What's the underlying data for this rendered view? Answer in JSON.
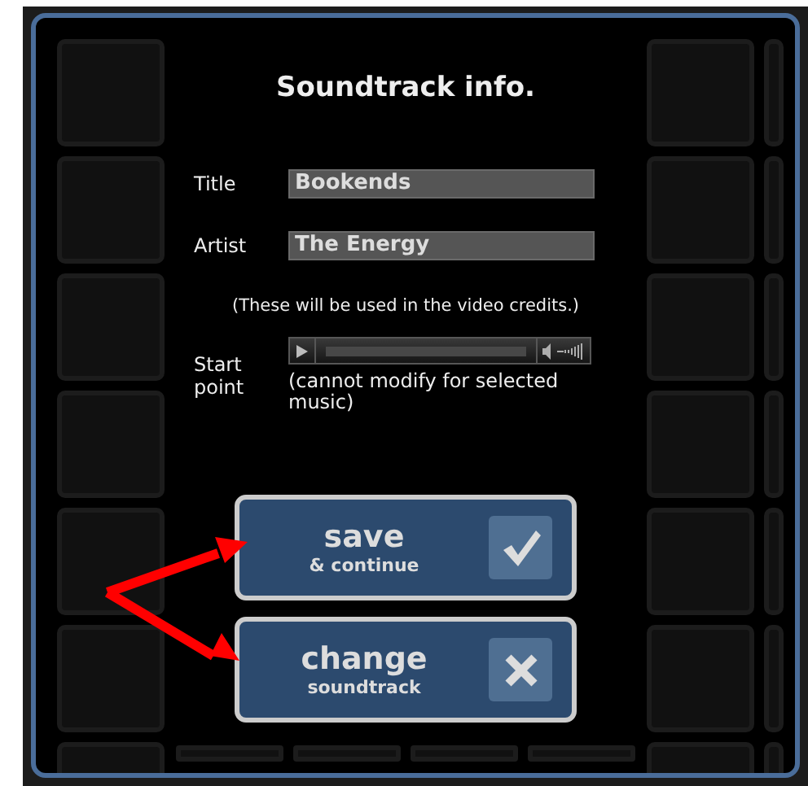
{
  "title": "Soundtrack info.",
  "fields": [
    {
      "label": "Title",
      "value": "Bookends"
    },
    {
      "label": "Artist",
      "value": "The Energy"
    }
  ],
  "credits_note": "(These will be used in the video credits.)",
  "start_point": {
    "label": "Start point",
    "note": "(cannot modify for selected music)",
    "disabled": true
  },
  "buttons": [
    {
      "kind": "confirm",
      "label": "save",
      "sublabel": "& continue"
    },
    {
      "kind": "cancel",
      "label": "change",
      "sublabel": "soundtrack"
    }
  ]
}
